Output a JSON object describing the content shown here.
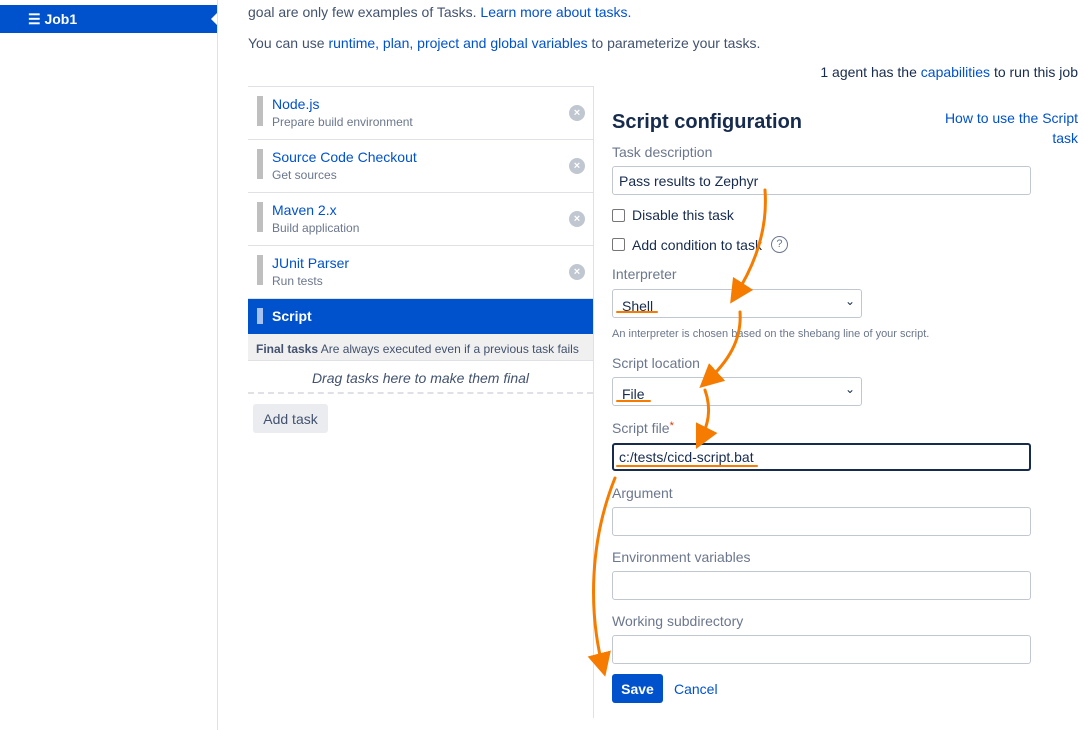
{
  "sidebar": {
    "job_label": "Job1"
  },
  "intro": {
    "line1_text": "goal are only few examples of Tasks.",
    "line1_link": "Learn more about tasks.",
    "line2_pre": "You can use",
    "line2_link": "runtime, plan, project and global variables",
    "line2_post": "to parameterize your tasks.",
    "agent_pre": "1 agent has the",
    "agent_link": "capabilities",
    "agent_post": "to run this job"
  },
  "tasks": [
    {
      "name": "Node.js",
      "desc": "Prepare build environment"
    },
    {
      "name": "Source Code Checkout",
      "desc": "Get sources"
    },
    {
      "name": "Maven 2.x",
      "desc": "Build application"
    },
    {
      "name": "JUnit Parser",
      "desc": "Run tests"
    }
  ],
  "selected_task": "Script",
  "final": {
    "title": "Final tasks",
    "desc": "Are always executed even if a previous task fails",
    "drag": "Drag tasks here to make them final"
  },
  "add_task": "Add task",
  "config": {
    "title": "Script configuration",
    "help_link": "How to use the Script task",
    "task_description_label": "Task description",
    "task_description": "Pass results to Zephyr",
    "disable_label": "Disable this task",
    "condition_label": "Add condition to task",
    "interpreter_label": "Interpreter",
    "interpreter": "Shell",
    "interpreter_hint": "An interpreter is chosen based on the shebang line of your script.",
    "location_label": "Script location",
    "location": "File",
    "file_label": "Script file",
    "required_mark": "*",
    "file": "c:/tests/cicd-script.bat",
    "argument_label": "Argument",
    "argument": "",
    "env_label": "Environment variables",
    "env": "",
    "workdir_label": "Working subdirectory",
    "workdir": "",
    "save": "Save",
    "cancel": "Cancel"
  },
  "colors": {
    "accent": "#0052cc",
    "annotation": "#f57c00"
  }
}
